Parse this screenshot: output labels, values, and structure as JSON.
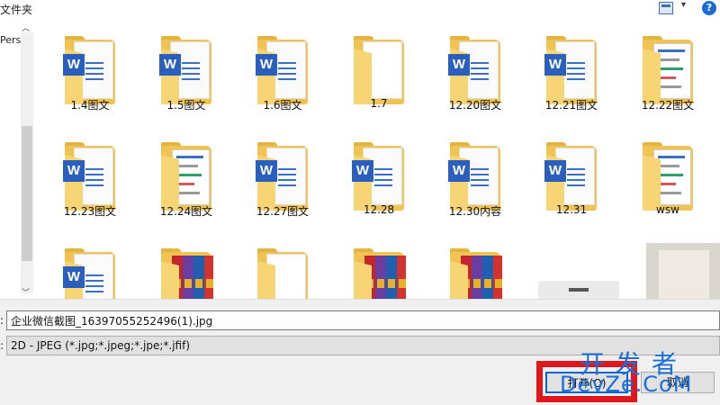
{
  "header": {
    "breadcrumb": "文件夹",
    "help_label": "?",
    "view_arrow": "▾"
  },
  "left_pane": {
    "label": "Perso",
    "scroll_up": "︿",
    "scroll_down": "﹀"
  },
  "files": [
    {
      "name": "1.4图文",
      "kind": "word"
    },
    {
      "name": "1.5图文",
      "kind": "word"
    },
    {
      "name": "1.6图文",
      "kind": "word"
    },
    {
      "name": "1.7",
      "kind": "plain"
    },
    {
      "name": "12.20图文",
      "kind": "word"
    },
    {
      "name": "12.21图文",
      "kind": "word"
    },
    {
      "name": "12.22图文",
      "kind": "preview"
    },
    {
      "name": "12.23图文",
      "kind": "word"
    },
    {
      "name": "12.24图文",
      "kind": "preview"
    },
    {
      "name": "12.27图文",
      "kind": "word"
    },
    {
      "name": "12.28",
      "kind": "word"
    },
    {
      "name": "12.30内容",
      "kind": "word"
    },
    {
      "name": "12.31",
      "kind": "word"
    },
    {
      "name": "wsw",
      "kind": "preview"
    },
    {
      "name": "",
      "kind": "word"
    },
    {
      "name": "",
      "kind": "books"
    },
    {
      "name": "",
      "kind": "plain"
    },
    {
      "name": "",
      "kind": "books"
    },
    {
      "name": "",
      "kind": "books"
    }
  ],
  "bottom": {
    "filename_label": ":",
    "filename_value": "企业微信截图_16397055252496(1).jpg",
    "filetype_label": ":",
    "filetype_value": "2D - JPEG (*.jpg;*.jpeg;*.jpe;*.jfif)",
    "open_label": "打开(O)",
    "cancel_label": "取消"
  },
  "watermark": {
    "cn": "开发者",
    "en": "DevZe.CoM"
  },
  "colors": {
    "folder": "#f0c453",
    "word_blue": "#2b5fbd",
    "highlight_red": "#e0161d",
    "watermark_blue": "#1b6ed6"
  }
}
